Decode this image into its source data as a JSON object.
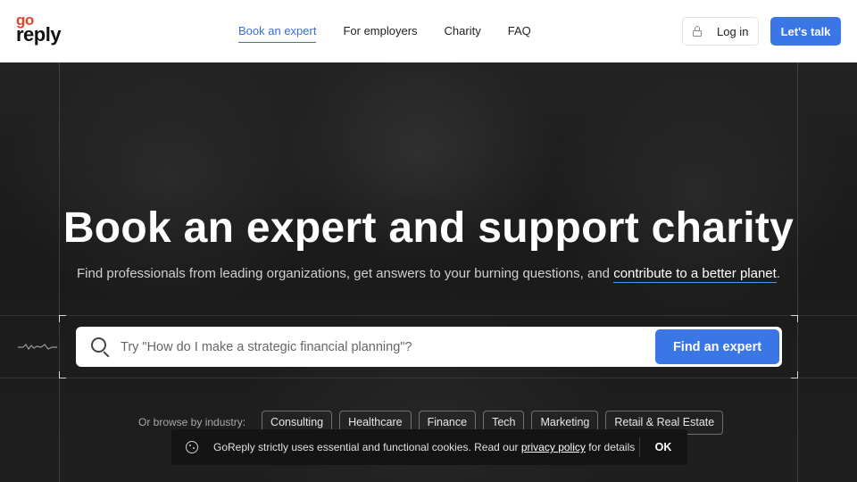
{
  "header": {
    "logo_top": "go",
    "logo_bottom": "reply",
    "nav": [
      {
        "label": "Book an expert",
        "active": true
      },
      {
        "label": "For employers",
        "active": false
      },
      {
        "label": "Charity",
        "active": false
      },
      {
        "label": "FAQ",
        "active": false
      }
    ],
    "login_label": "Log in",
    "cta_label": "Let's talk"
  },
  "hero": {
    "title": "Book an expert and support charity",
    "subtitle_start": "Find professionals from leading organizations, get answers to your burning questions, and ",
    "subtitle_highlight": "contribute to a better planet",
    "subtitle_end": ".",
    "search_placeholder": "Try \"How do I make a strategic financial planning\"?",
    "search_button": "Find an expert",
    "browse_label": "Or browse by industry:",
    "industries": [
      "Consulting",
      "Healthcare",
      "Finance",
      "Tech",
      "Marketing",
      "Retail & Real Estate"
    ]
  },
  "cookie": {
    "text_start": "GoReply strictly uses essential and functional cookies. Read our ",
    "link_text": "privacy policy",
    "text_end": " for details",
    "ok_label": "OK"
  },
  "colors": {
    "brand_red": "#e8412c",
    "accent_blue": "#3b76e6",
    "link_blue": "#3a6fd8"
  }
}
